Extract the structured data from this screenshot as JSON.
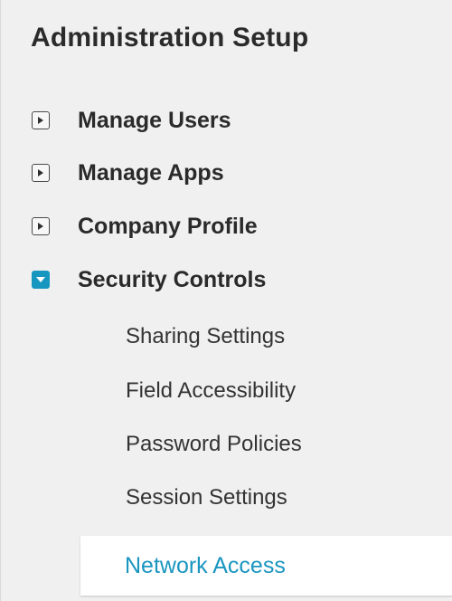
{
  "header": {
    "title": "Administration Setup"
  },
  "sections": [
    {
      "label": "Manage Users",
      "state": "collapsed",
      "icon": "expand-arrow-icon"
    },
    {
      "label": "Manage Apps",
      "state": "collapsed",
      "icon": "expand-arrow-icon"
    },
    {
      "label": "Company Profile",
      "state": "collapsed",
      "icon": "expand-arrow-icon"
    },
    {
      "label": "Security Controls",
      "state": "expanded",
      "icon": "collapse-arrow-icon"
    }
  ],
  "security_controls": {
    "items": [
      {
        "label": "Sharing Settings"
      },
      {
        "label": "Field Accessibility"
      },
      {
        "label": "Password Policies"
      },
      {
        "label": "Session Settings"
      },
      {
        "label": "Network Access",
        "selected": true
      }
    ]
  },
  "colors": {
    "accent": "#1797C0",
    "selected_text": "#1A96C0",
    "background": "#F0F0F0"
  }
}
